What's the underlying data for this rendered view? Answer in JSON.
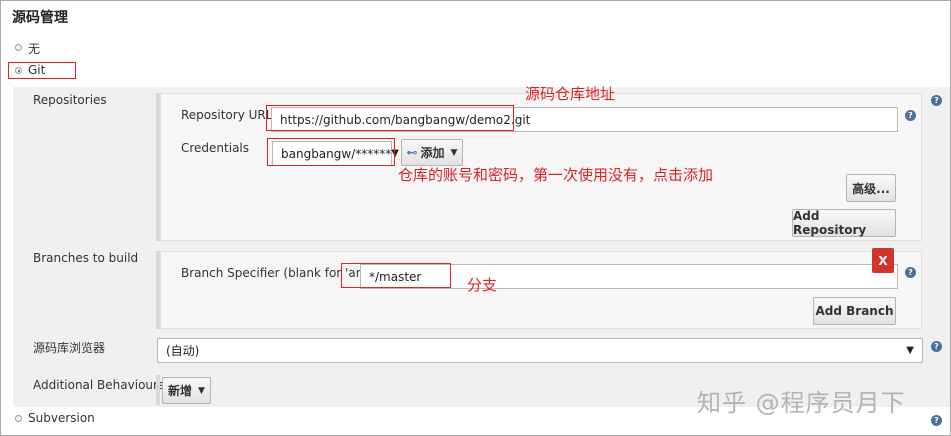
{
  "section_title": "源码管理",
  "scm_options": {
    "none": "无",
    "git": "Git",
    "subversion": "Subversion"
  },
  "repositories": {
    "label": "Repositories",
    "url_label": "Repository URL",
    "url_value": "https://github.com/bangbangw/demo2.git",
    "credentials_label": "Credentials",
    "credentials_value": "bangbangw/******",
    "add_button": "添加",
    "advanced_button": "高级...",
    "add_repository_button": "Add Repository"
  },
  "branches": {
    "label": "Branches to build",
    "specifier_label": "Branch Specifier (blank for 'any')",
    "specifier_value": "*/master",
    "delete_button": "X",
    "add_branch_button": "Add Branch"
  },
  "browser": {
    "label": "源码库浏览器",
    "value": "(自动)"
  },
  "behaviours": {
    "label": "Additional Behaviours",
    "add_button": "新增"
  },
  "annotations": {
    "repo_url": "源码仓库地址",
    "credentials": "仓库的账号和密码，第一次使用没有，点击添加",
    "branch": "分支"
  },
  "help_glyph": "?",
  "watermark": "知乎 @程序员月下",
  "colors": {
    "annotation_red": "#d22222",
    "help_blue": "#4b6f9c",
    "delete_red": "#d0342c"
  }
}
